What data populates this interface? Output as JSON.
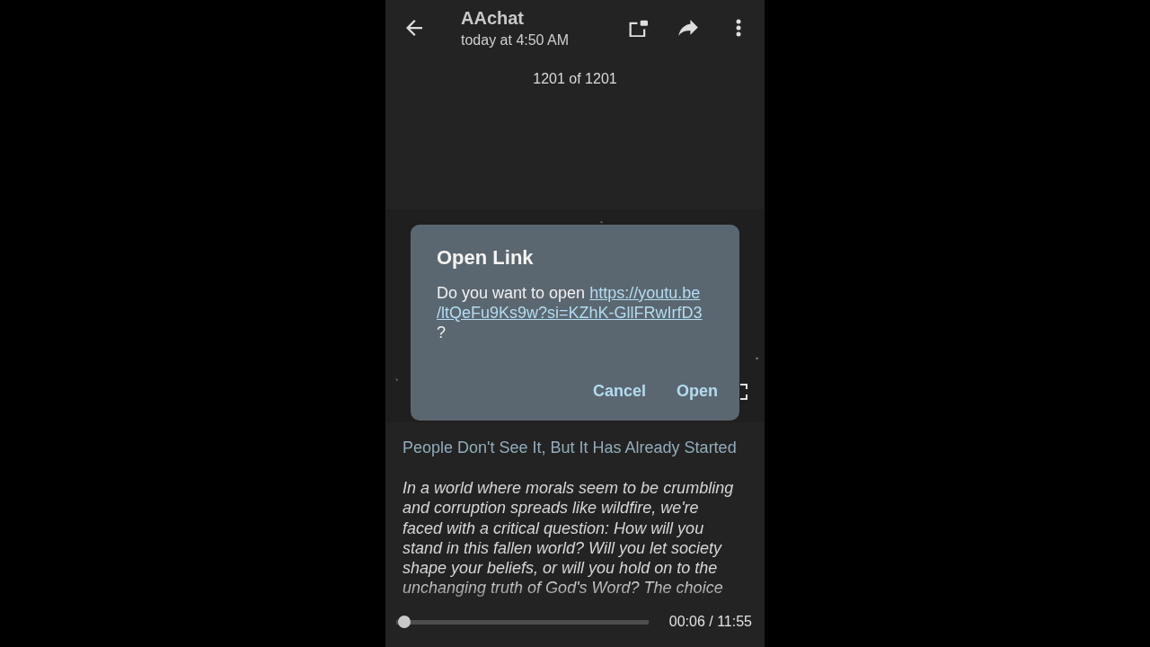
{
  "header": {
    "title": "AAchat",
    "subtitle": "today at 4:50 AM"
  },
  "counter": "1201 of 1201",
  "dialog": {
    "title": "Open Link",
    "message": {
      "before": "Do you want to open",
      "link_lines": [
        "https://youtu.be",
        "/ltQeFu9Ks9w?si=KZhK-GllFRwIrfD3"
      ],
      "after": "?"
    },
    "buttons": [
      "Cancel",
      "Open"
    ]
  },
  "post": {
    "heading": "People Don't See It, But It Has Already Started",
    "body": "In a world where morals seem to be crumbling and corruption spreads like wildfire, we're faced with a critical question: How will you stand in this fallen world? Will you let society shape your beliefs, or will you hold on to the unchanging truth of God's Word? The choice"
  },
  "player": {
    "level": 0.0084,
    "time": "00:06 / 11:55"
  }
}
